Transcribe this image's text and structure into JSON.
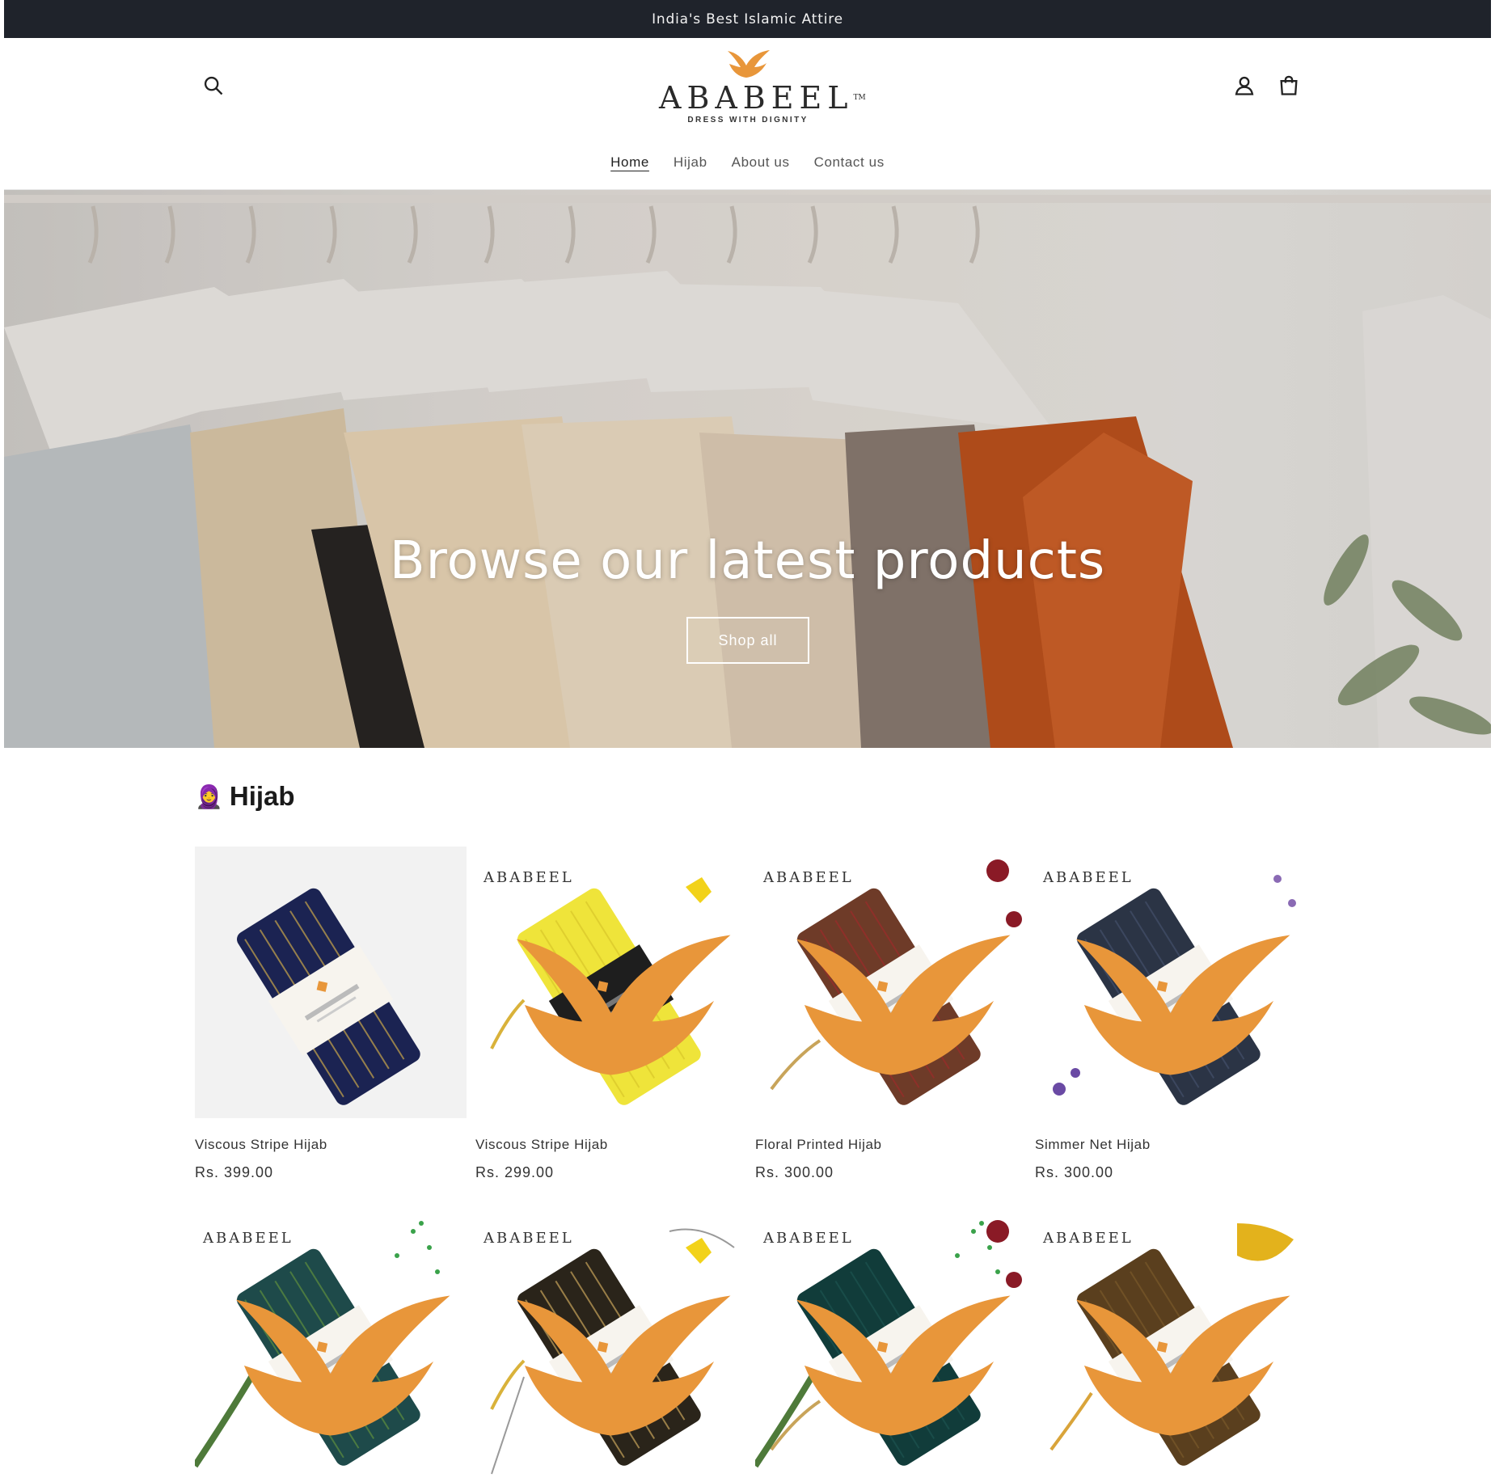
{
  "announcement": "India's Best Islamic Attire",
  "header": {
    "logo": {
      "brand": "ABABEEL",
      "tm": "TM",
      "tagline": "DRESS WITH DIGNITY"
    },
    "icons": {
      "search": "search-icon",
      "account": "user-icon",
      "cart": "cart-icon"
    }
  },
  "nav": {
    "items": [
      {
        "label": "Home",
        "active": true
      },
      {
        "label": "Hijab",
        "active": false
      },
      {
        "label": "About us",
        "active": false
      },
      {
        "label": "Contact us",
        "active": false
      }
    ]
  },
  "hero": {
    "title": "Browse our latest products",
    "button": "Shop all"
  },
  "collection": {
    "emoji": "🧕",
    "title": "Hijab",
    "products": [
      {
        "name": "Viscous Stripe Hijab",
        "price": "Rs. 399.00",
        "color": "#1b2352",
        "accent": "#c9a64a",
        "bg": "grey",
        "logo": false
      },
      {
        "name": "Viscous Stripe Hijab",
        "price": "Rs. 299.00",
        "color": "#efe43a",
        "accent": "#d9c72a",
        "bg": "white",
        "logo": true
      },
      {
        "name": "Floral Printed Hijab",
        "price": "Rs. 300.00",
        "color": "#6e3b28",
        "accent": "#9c2a2a",
        "bg": "white",
        "logo": true
      },
      {
        "name": "Simmer Net Hijab",
        "price": "Rs. 300.00",
        "color": "#2b3445",
        "accent": "#44506a",
        "bg": "white",
        "logo": true
      },
      {
        "name": "",
        "price": "",
        "color": "#1e4a4a",
        "accent": "#5f8f3e",
        "bg": "white",
        "logo": true
      },
      {
        "name": "",
        "price": "",
        "color": "#2a241a",
        "accent": "#c8a45a",
        "bg": "white",
        "logo": true
      },
      {
        "name": "",
        "price": "",
        "color": "#113c3a",
        "accent": "#1d5450",
        "bg": "white",
        "logo": true
      },
      {
        "name": "",
        "price": "",
        "color": "#5a3f1e",
        "accent": "#7a5a2a",
        "bg": "white",
        "logo": true
      }
    ]
  },
  "colors": {
    "announcement_bg": "#1f232b",
    "logo_orange": "#e8963a",
    "text": "#222222"
  }
}
